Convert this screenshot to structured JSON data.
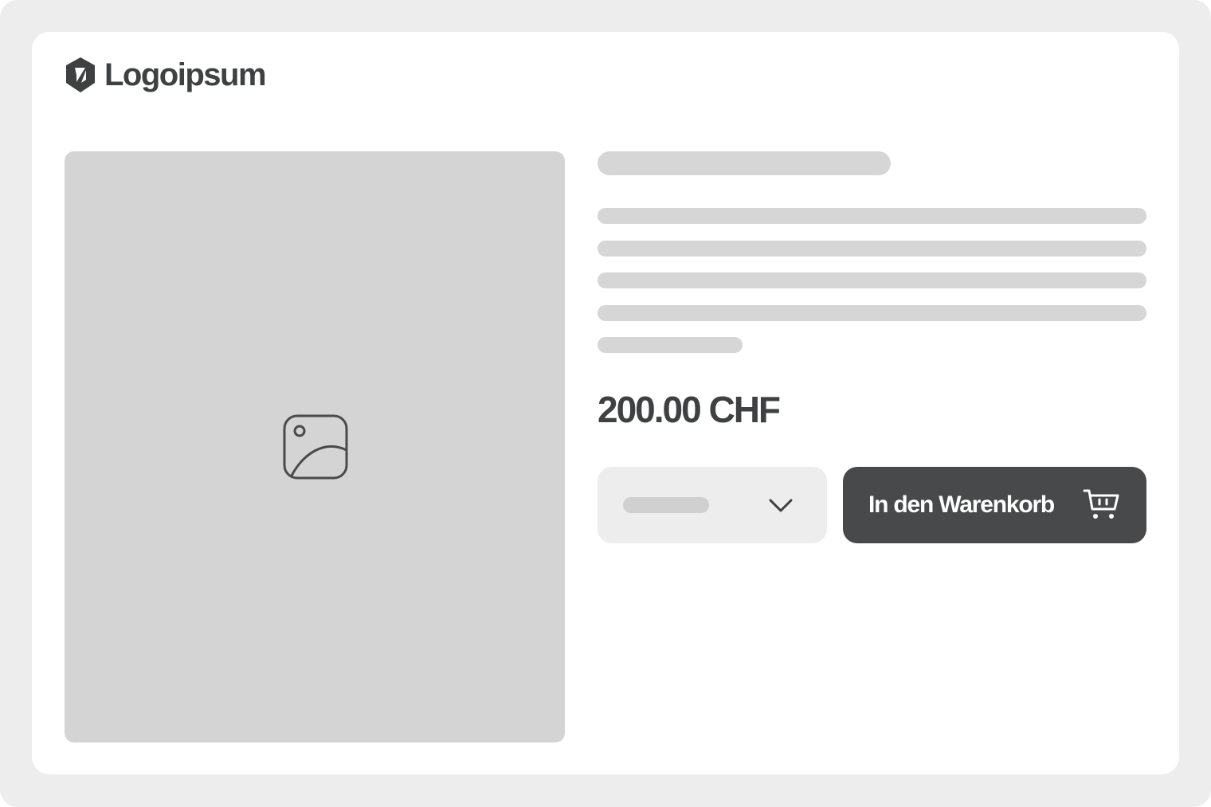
{
  "header": {
    "logo_text": "Logoipsum",
    "logo_icon": "logoipsum-hexagon-mark"
  },
  "product": {
    "image_icon": "image-placeholder-icon",
    "price": "200.00 CHF"
  },
  "variant_select": {
    "chevron_icon": "chevron-down-icon"
  },
  "cart_button": {
    "label": "In den Warenkorb",
    "icon": "shopping-cart-icon"
  },
  "colors": {
    "frame": "#ecedec",
    "card": "#ffffff",
    "placeholder": "#d4d4d4",
    "skeleton": "#d6d6d6",
    "text_dark": "#3f4042",
    "button_bg": "#48494b",
    "button_text": "#ffffff"
  }
}
